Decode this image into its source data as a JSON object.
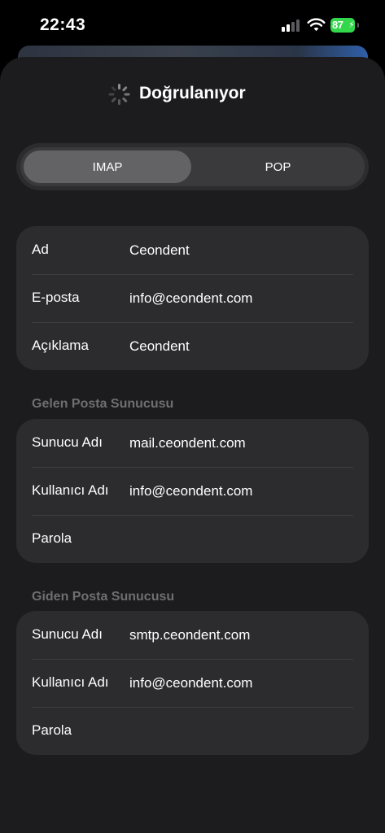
{
  "status_bar": {
    "time": "22:43",
    "battery": "87",
    "battery_color": "#32d74b"
  },
  "header": {
    "title": "Doğrulanıyor",
    "spinner_icon": "activity-spinner-icon"
  },
  "segmented": {
    "options": [
      "IMAP",
      "POP"
    ],
    "selected": "IMAP"
  },
  "account": {
    "rows": [
      {
        "label": "Ad",
        "value": "Ceondent"
      },
      {
        "label": "E-posta",
        "value": "info@ceondent.com"
      },
      {
        "label": "Açıklama",
        "value": "Ceondent"
      }
    ]
  },
  "incoming": {
    "header": "Gelen Posta Sunucusu",
    "rows": [
      {
        "label": "Sunucu Adı",
        "value": "mail.ceondent.com"
      },
      {
        "label": "Kullanıcı Adı",
        "value": "info@ceondent.com"
      },
      {
        "label": "Parola",
        "value": ""
      }
    ]
  },
  "outgoing": {
    "header": "Giden Posta Sunucusu",
    "rows": [
      {
        "label": "Sunucu Adı",
        "value": "smtp.ceondent.com"
      },
      {
        "label": "Kullanıcı Adı",
        "value": "info@ceondent.com"
      },
      {
        "label": "Parola",
        "value": ""
      }
    ]
  }
}
